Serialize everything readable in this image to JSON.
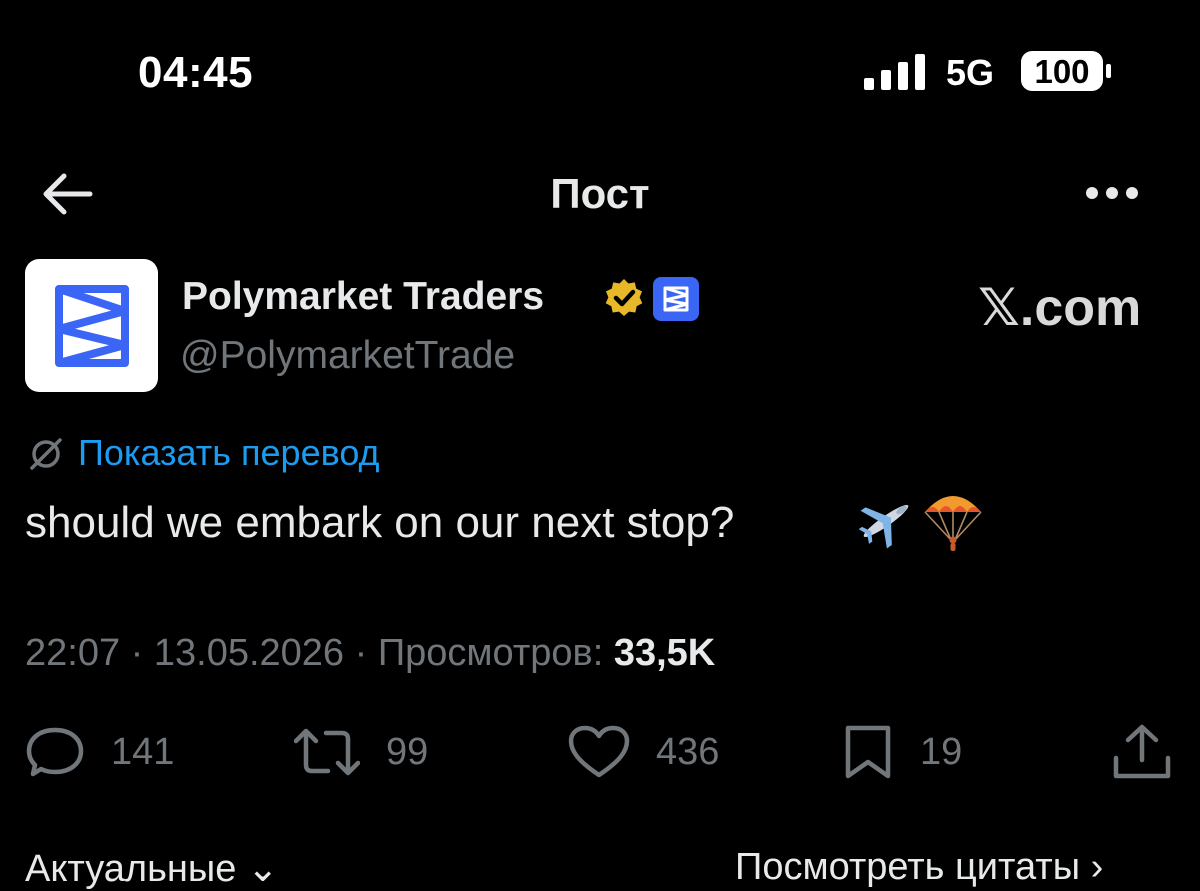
{
  "status_bar": {
    "time": "04:45",
    "network": "5G",
    "battery": "100"
  },
  "header": {
    "title": "Пост"
  },
  "author": {
    "name": "Polymarket Traders",
    "handle": "@PolymarketTrade",
    "verified": true,
    "watermark": "𝕏.com"
  },
  "translate": {
    "label": "Показать перевод"
  },
  "tweet": {
    "text": "should we embark on our next stop?",
    "emojis": [
      "airplane",
      "parachute"
    ]
  },
  "meta": {
    "time": "22:07",
    "date": "13.05.2026",
    "views_label": "Просмотров:",
    "views_count": "33,5K"
  },
  "actions": {
    "replies": "141",
    "retweets": "99",
    "likes": "436",
    "bookmarks": "19"
  },
  "bottom": {
    "left_label": "Актуальные ⌄",
    "right_label": "Посмотреть цитаты ›"
  },
  "colors": {
    "background": "#000000",
    "text": "#e7e9ea",
    "muted": "#71767b",
    "link": "#1d9bf0",
    "brand": "#3b66f5",
    "verified_gold": "#e8b829"
  }
}
